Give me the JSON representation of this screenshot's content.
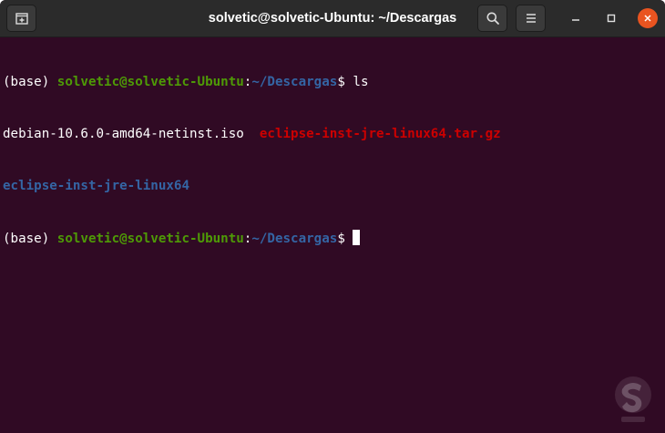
{
  "window": {
    "title": "solvetic@solvetic-Ubuntu: ~/Descargas",
    "icons": {
      "new_tab": "new-tab-icon",
      "search": "search-icon",
      "menu": "hamburger-menu-icon",
      "minimize": "minimize-icon",
      "maximize": "maximize-icon",
      "close": "close-icon"
    },
    "colors": {
      "background": "#300a24",
      "titlebar": "#2b2b2b",
      "close_button": "#e95420",
      "user_host": "#4e9a06",
      "path": "#3465a4",
      "archive": "#cc0000"
    }
  },
  "terminal": {
    "line1": {
      "env": "(base) ",
      "user_host": "solvetic@solvetic-Ubuntu",
      "colon": ":",
      "path": "~/Descargas",
      "prompt": "$ ",
      "command": "ls"
    },
    "line2": {
      "file1": "debian-10.6.0-amd64-netinst.iso",
      "gap": "  ",
      "file2": "eclipse-inst-jre-linux64.tar.gz"
    },
    "line3": {
      "dir1": "eclipse-inst-jre-linux64"
    },
    "line4": {
      "env": "(base) ",
      "user_host": "solvetic@solvetic-Ubuntu",
      "colon": ":",
      "path": "~/Descargas",
      "prompt": "$ "
    }
  },
  "watermark": {
    "icon": "solvetic-logo-icon"
  }
}
